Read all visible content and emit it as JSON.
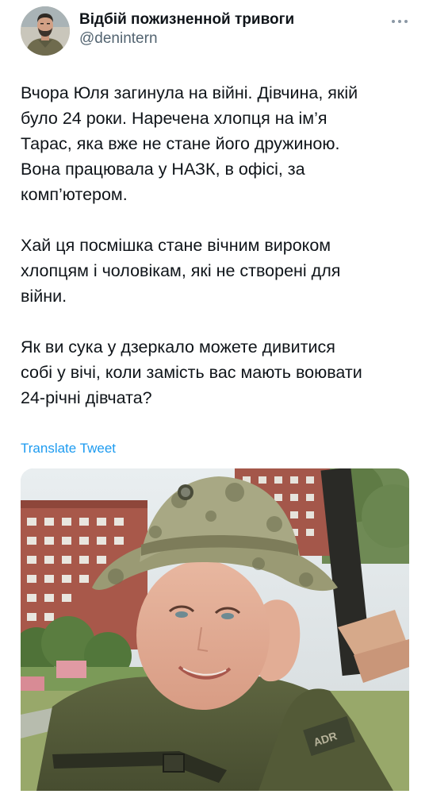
{
  "author": {
    "name": "Відбій пожизненной тривоги",
    "handle": "@denintern",
    "avatar_icon": "profile-avatar"
  },
  "more_icon": "more-options-icon",
  "tweet": {
    "paragraphs": [
      "Вчора Юля загинула на війні. Дівчина, якій\nбуло 24 роки. Наречена хлопця на ім’я\nТарас, яка вже не стане його дружиною.\nВона працювала у НАЗК, в офісі, за\nкомп’ютером.",
      "Хай ця посмішка стане вічним вироком\nхлопцям і чоловікам, які не створені для\nвійни.",
      "Як ви сука у дзеркало можете дивитися\nсобі у вічі, коли замість вас мають воювати\n24-річні дівчата?"
    ],
    "translate_label": "Translate Tweet"
  },
  "media": {
    "kind": "photo",
    "subject": "smiling woman in camouflage boonie hat and olive fleece, apartment buildings behind",
    "patch_text": "ADR"
  },
  "colors": {
    "text": "#0f1419",
    "secondary": "#536471",
    "link": "#1d9bf0"
  }
}
